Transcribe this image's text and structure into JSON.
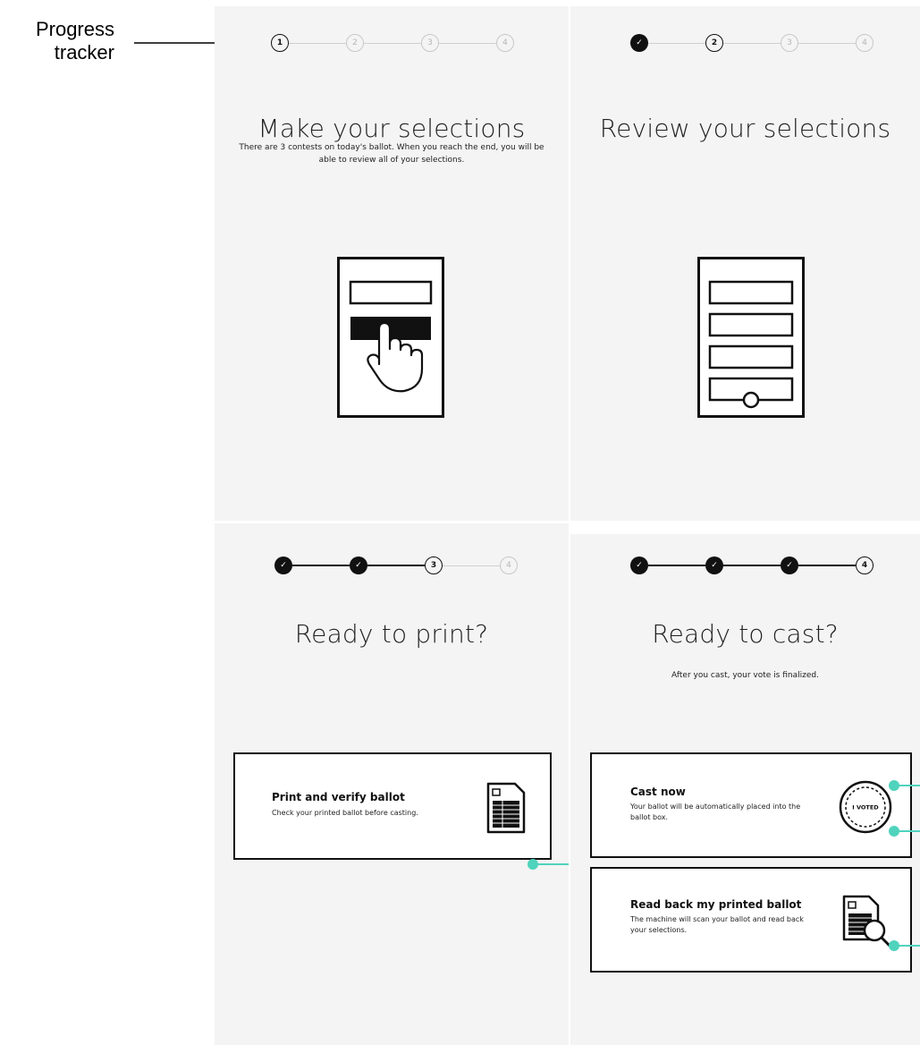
{
  "annotation": {
    "line1": "Progress",
    "line2": "tracker"
  },
  "screens": [
    {
      "title": "Make your selections",
      "subtitle": "There are 3 contests on today's ballot. When you reach the end, you will be able to review all of your selections.",
      "steps": [
        {
          "label": "1",
          "state": "current"
        },
        {
          "label": "2",
          "state": "pending"
        },
        {
          "label": "3",
          "state": "pending"
        },
        {
          "label": "4",
          "state": "pending"
        }
      ]
    },
    {
      "title": "Review your selections",
      "steps": [
        {
          "label": "✓",
          "state": "done"
        },
        {
          "label": "2",
          "state": "current"
        },
        {
          "label": "3",
          "state": "pending"
        },
        {
          "label": "4",
          "state": "pending"
        }
      ]
    },
    {
      "title": "Ready to print?",
      "steps": [
        {
          "label": "✓",
          "state": "done"
        },
        {
          "label": "✓",
          "state": "done"
        },
        {
          "label": "3",
          "state": "current"
        },
        {
          "label": "4",
          "state": "pending"
        }
      ],
      "options": [
        {
          "title": "Print and verify ballot",
          "description": "Check your printed ballot before casting.",
          "icon": "printed-ballot-icon"
        }
      ]
    },
    {
      "title": "Ready to cast?",
      "subtitle": "After you cast, your vote is finalized.",
      "steps": [
        {
          "label": "✓",
          "state": "done"
        },
        {
          "label": "✓",
          "state": "done"
        },
        {
          "label": "✓",
          "state": "done"
        },
        {
          "label": "4",
          "state": "current"
        }
      ],
      "options": [
        {
          "title": "Cast now",
          "description": "Your ballot will be automatically placed into the ballot box.",
          "icon": "i-voted-sticker-icon",
          "sticker_text": "I VOTED"
        },
        {
          "title": "Read back my printed ballot",
          "description": "The machine will scan your ballot and read back your selections.",
          "icon": "ballot-magnifier-icon"
        }
      ]
    }
  ],
  "colors": {
    "panel_bg": "#f4f4f4",
    "ink": "#111111",
    "pending": "#c8c8c8",
    "accent_teal": "#4fd3bd"
  }
}
